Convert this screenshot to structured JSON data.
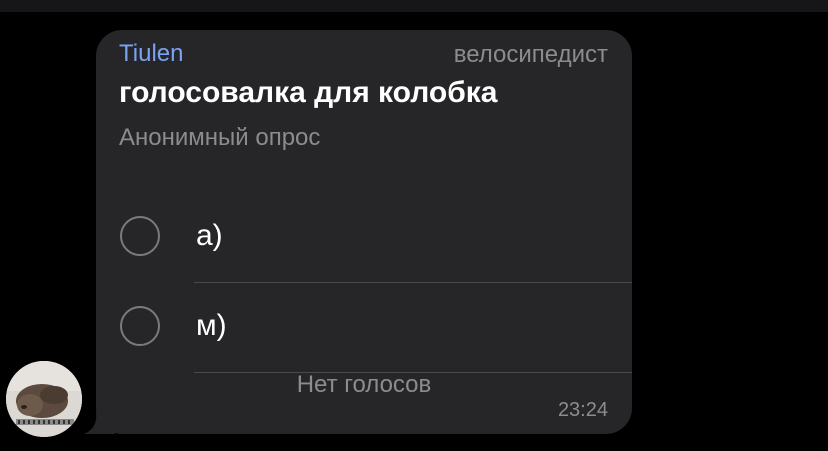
{
  "message": {
    "sender": "Tiulen",
    "sender_rank": "велосипедист",
    "time": "23:24"
  },
  "poll": {
    "question": "голосовалка для колобка",
    "type": "Анонимный опрос",
    "options": [
      {
        "label": "а)"
      },
      {
        "label": "м)"
      }
    ],
    "votes_text": "Нет голосов"
  },
  "colors": {
    "background": "#000000",
    "bubble": "#262628",
    "sender_name": "#7aa3f5",
    "secondary_text": "#8c8c8f",
    "primary_text": "#ffffff"
  },
  "icons": {
    "radio": "radio-unchecked-icon",
    "avatar": "user-avatar-photo"
  }
}
